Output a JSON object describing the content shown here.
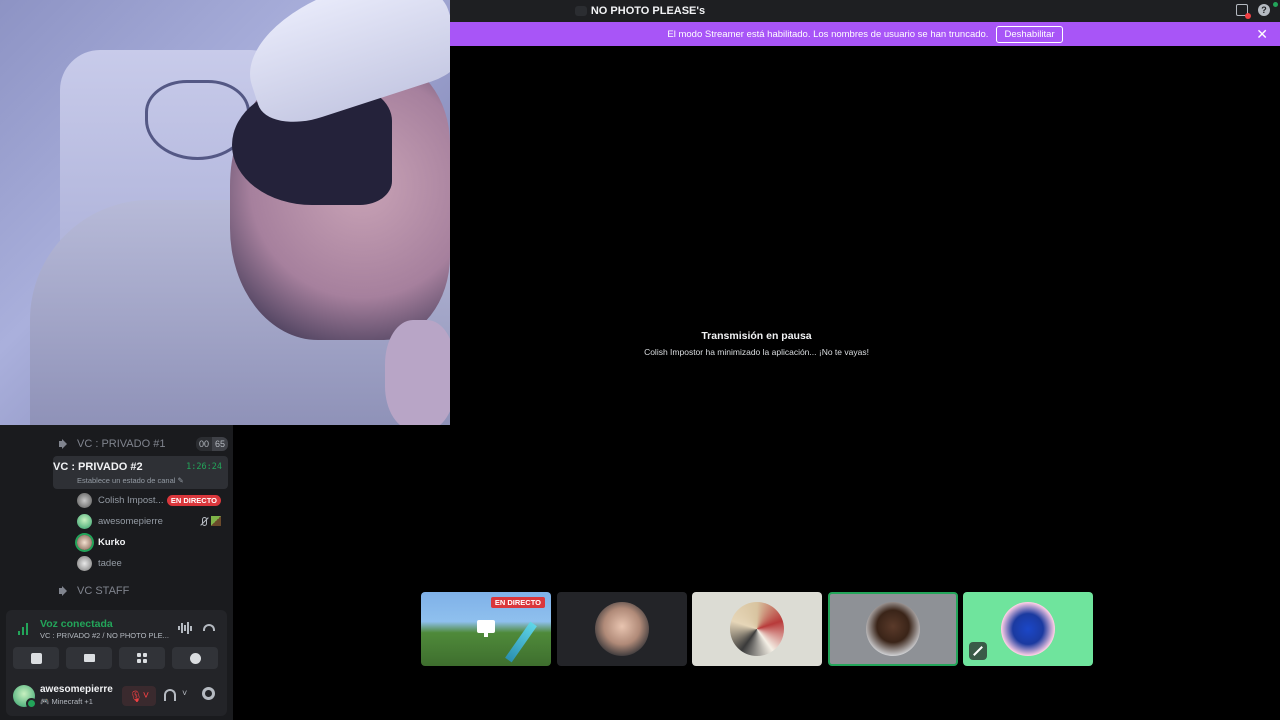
{
  "window": {
    "title": "NO PHOTO PLEASE's"
  },
  "banner": {
    "text": "El modo Streamer está habilitado. Los nombres de usuario se han truncado.",
    "disable_label": "Deshabilitar",
    "color": "#a855f7"
  },
  "channels": [
    {
      "name": "VC : PRIVADO #1",
      "counts": [
        "00",
        "65"
      ]
    },
    {
      "name": "VC : PRIVADO #2",
      "timer": "1:26:24",
      "status": "Establece un estado de canal"
    },
    {
      "name": "VC STAFF"
    }
  ],
  "members": [
    {
      "name": "Colish Impost...",
      "badge": "EN DIRECTO"
    },
    {
      "name": "awesomepierre"
    },
    {
      "name": "Kurko"
    },
    {
      "name": "tadee"
    }
  ],
  "voice_panel": {
    "title": "Voz conectada",
    "subtitle": "VC : PRIVADO #2 / NO PHOTO PLE...",
    "status_color": "#23a55a"
  },
  "user_panel": {
    "username": "awesomepierre",
    "activity": "Minecraft +1"
  },
  "stream": {
    "title": "Transmisión en pausa",
    "message": "Colish Impostor ha minimizado la aplicación... ¡No te vayas!"
  },
  "tiles": [
    {
      "badge": "EN DIRECTO",
      "type": "stream"
    },
    {
      "type": "avatar"
    },
    {
      "type": "avatar"
    },
    {
      "type": "avatar",
      "speaking": true
    },
    {
      "type": "avatar",
      "muted": true
    }
  ]
}
